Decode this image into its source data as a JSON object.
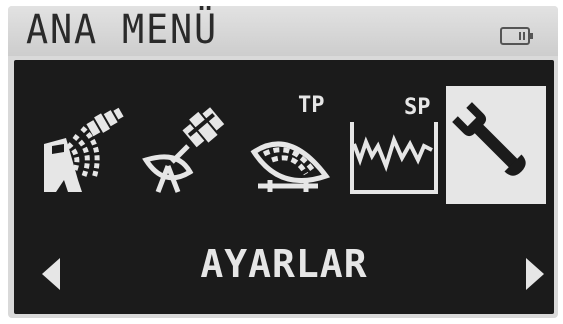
{
  "header": {
    "title": "ANA MENÜ",
    "battery_icon": "battery-icon"
  },
  "menu": {
    "items": [
      {
        "id": "satellite-dish",
        "icon": "satellite-dish-icon",
        "badge": ""
      },
      {
        "id": "satellite",
        "icon": "satellite-icon",
        "badge": ""
      },
      {
        "id": "transponder",
        "icon": "dish-tp-icon",
        "badge": "TP"
      },
      {
        "id": "spectrum",
        "icon": "spectrum-sp-icon",
        "badge": "SP"
      },
      {
        "id": "settings",
        "icon": "wrench-icon",
        "badge": ""
      }
    ],
    "selected_index": 4,
    "selected_label": "AYARLAR",
    "left_arrow_icon": "arrow-left-icon",
    "right_arrow_icon": "arrow-right-icon"
  },
  "colors": {
    "lcd_background": "#d9d9d9",
    "panel_background": "#1b1b1b",
    "foreground": "#e6e6e6",
    "title_text": "#2a2a2a"
  }
}
